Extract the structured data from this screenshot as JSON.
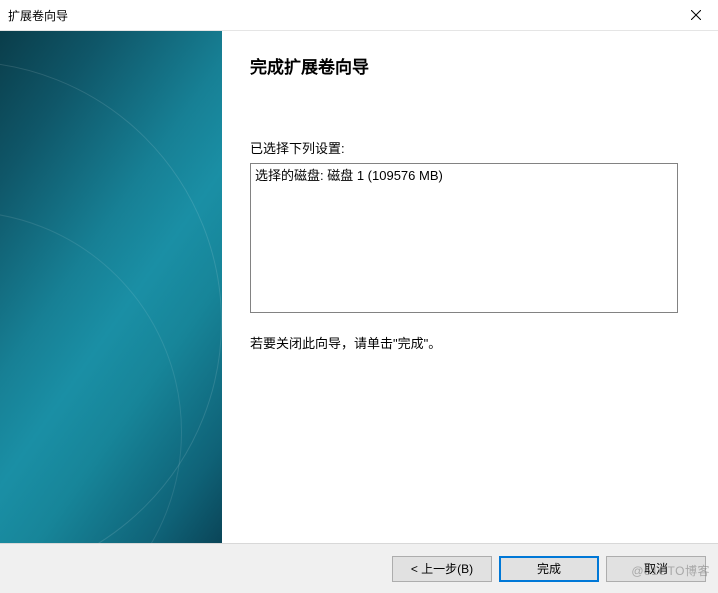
{
  "titlebar": {
    "title": "扩展卷向导"
  },
  "main": {
    "heading": "完成扩展卷向导",
    "settings_label": "已选择下列设置:",
    "settings_items": [
      "选择的磁盘: 磁盘 1 (109576 MB)"
    ],
    "hint": "若要关闭此向导，请单击\"完成\"。"
  },
  "buttons": {
    "back": "< 上一步(B)",
    "finish": "完成",
    "cancel": "取消"
  },
  "watermark": "@51CTO博客"
}
